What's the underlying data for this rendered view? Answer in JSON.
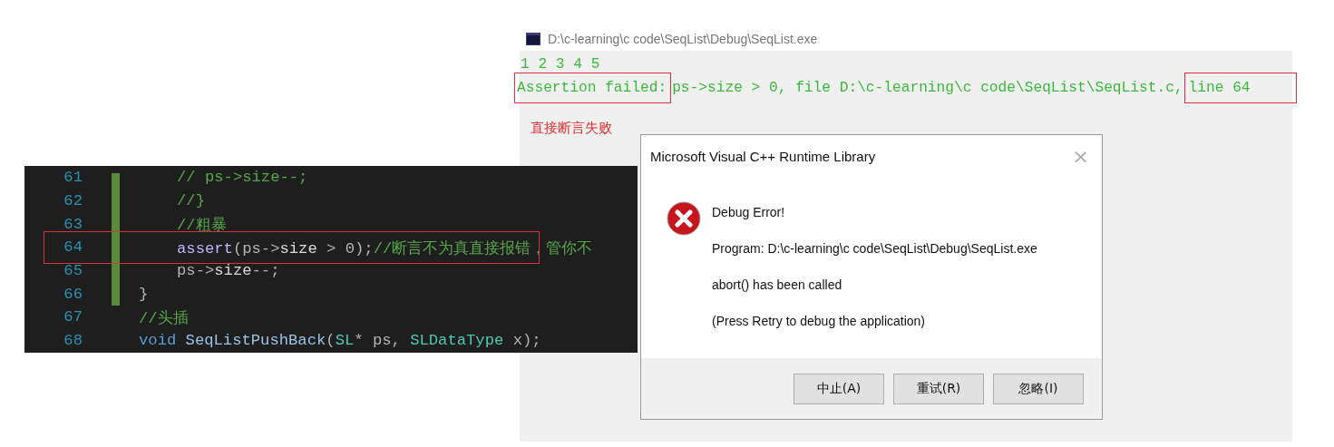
{
  "console": {
    "title": "D:\\c-learning\\c code\\SeqList\\Debug\\SeqList.exe",
    "lines": [
      [
        {
          "text": "1 2 3 4 5",
          "framed": false
        }
      ],
      [
        {
          "text": "Assertion failed:",
          "framed": true
        },
        {
          "text": " ps->size > 0, file D:\\c-learning\\c code\\SeqList\\SeqList.c,",
          "framed": false
        },
        {
          "text": " line 64",
          "framed": true
        }
      ]
    ]
  },
  "annotation": "直接断言失败",
  "editor": {
    "lines": [
      {
        "number": "61",
        "kind": "inner",
        "framed": false,
        "tokens": [
          {
            "kind": "comment",
            "text": "//  ps->size--;"
          }
        ]
      },
      {
        "number": "62",
        "kind": "inner",
        "framed": false,
        "tokens": [
          {
            "kind": "comment",
            "text": "//}"
          }
        ]
      },
      {
        "number": "63",
        "kind": "inner",
        "framed": false,
        "tokens": [
          {
            "kind": "comment",
            "text": "//粗暴"
          }
        ]
      },
      {
        "number": "64",
        "kind": "inner",
        "framed": true,
        "tokens": [
          {
            "kind": "macro",
            "text": "assert"
          },
          {
            "kind": "punct",
            "text": "(ps->"
          },
          {
            "kind": "member",
            "text": "size"
          },
          {
            "kind": "punct",
            "text": " > 0);"
          },
          {
            "kind": "comment",
            "text": "//断言不为真直接报错，管你不"
          }
        ]
      },
      {
        "number": "65",
        "kind": "inner",
        "framed": false,
        "tokens": [
          {
            "kind": "punct",
            "text": "ps->"
          },
          {
            "kind": "member",
            "text": "size"
          },
          {
            "kind": "punct",
            "text": "--;"
          }
        ]
      },
      {
        "number": "66",
        "kind": "outer",
        "framed": false,
        "tokens": [
          {
            "kind": "punct",
            "text": "}"
          }
        ]
      },
      {
        "number": "67",
        "kind": "outer",
        "framed": false,
        "tokens": [
          {
            "kind": "comment",
            "text": "//头插"
          }
        ]
      },
      {
        "number": "68",
        "kind": "outer",
        "framed": false,
        "tokens": [
          {
            "kind": "keyword",
            "text": "void"
          },
          {
            "kind": "func",
            "text": " SeqListPushBack"
          },
          {
            "kind": "punct",
            "text": "("
          },
          {
            "kind": "type",
            "text": "SL"
          },
          {
            "kind": "punct",
            "text": "* ps, "
          },
          {
            "kind": "type",
            "text": "SLDataType"
          },
          {
            "kind": "punct",
            "text": " x);"
          }
        ]
      }
    ]
  },
  "dialog": {
    "title": "Microsoft Visual C++ Runtime Library",
    "close": "×",
    "messages": [
      "Debug Error!",
      "Program: D:\\c-learning\\c code\\SeqList\\Debug\\SeqList.exe",
      "abort() has been called",
      "(Press Retry to debug the application)"
    ],
    "buttons": [
      "中止(A)",
      "重试(R)",
      "忽略(I)"
    ]
  }
}
